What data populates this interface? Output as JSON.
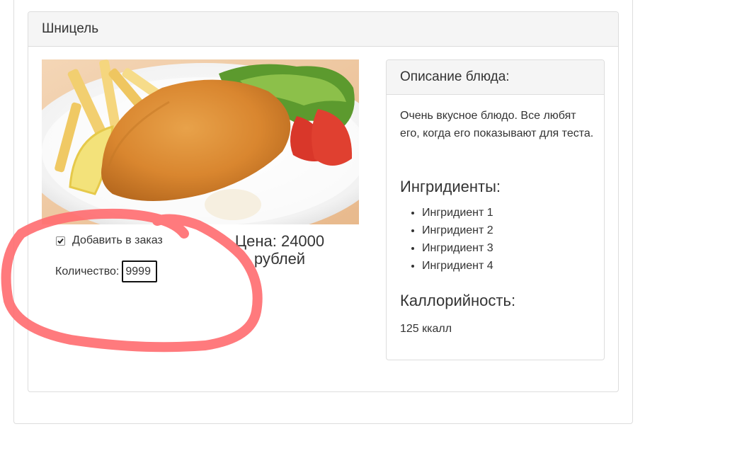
{
  "dish": {
    "title": "Шницель",
    "order_checkbox": {
      "label": "Добавить в заказ",
      "checked": true
    },
    "quantity": {
      "label": "Количество:",
      "value": "9999"
    },
    "price": {
      "line1": "Цена: 24000",
      "line2": "рублей"
    }
  },
  "description_panel": {
    "title": "Описание блюда:",
    "text": "Очень вкусное блюдо. Все любят его, когда его показывают для теста.",
    "ingredients_title": "Ингридиенты:",
    "ingredients": [
      "Ингридиент 1",
      "Ингридиент 2",
      "Ингридиент 3",
      "Ингридиент 4"
    ],
    "calories_title": "Каллорийность:",
    "calories_value": "125 ккалл"
  },
  "colors": {
    "annotation": "#ff6b6f",
    "panel_border": "#dddddd",
    "heading_bg": "#f5f5f5"
  },
  "icons": {
    "photo": "schnitzel-photo",
    "checkbox": "checkmark-icon"
  }
}
